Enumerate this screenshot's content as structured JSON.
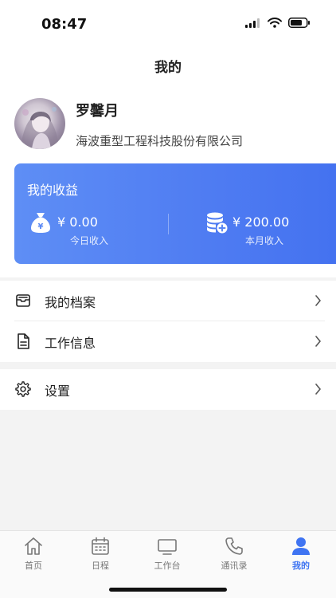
{
  "status_bar": {
    "time": "08:47"
  },
  "header": {
    "title": "我的"
  },
  "profile": {
    "name": "罗馨月",
    "company": "海波重型工程科技股份有限公司"
  },
  "earnings": {
    "title": "我的收益",
    "today": {
      "value": "¥  0.00",
      "label": "今日收入"
    },
    "month": {
      "value": "¥ 200.00",
      "label": "本月收入"
    }
  },
  "menu": {
    "items": [
      {
        "label": "我的档案",
        "icon": "archive-icon"
      },
      {
        "label": "工作信息",
        "icon": "document-icon"
      }
    ],
    "settings": {
      "label": "设置",
      "icon": "gear-icon"
    }
  },
  "tabbar": {
    "tabs": [
      {
        "label": "首页",
        "icon": "home-icon"
      },
      {
        "label": "日程",
        "icon": "calendar-icon"
      },
      {
        "label": "工作台",
        "icon": "monitor-icon"
      },
      {
        "label": "通讯录",
        "icon": "phone-icon"
      },
      {
        "label": "我的",
        "icon": "person-icon"
      }
    ],
    "active_index": 4
  },
  "colors": {
    "accent": "#3f74f2",
    "card_start": "#5e8ef5",
    "card_end": "#4472f0"
  }
}
